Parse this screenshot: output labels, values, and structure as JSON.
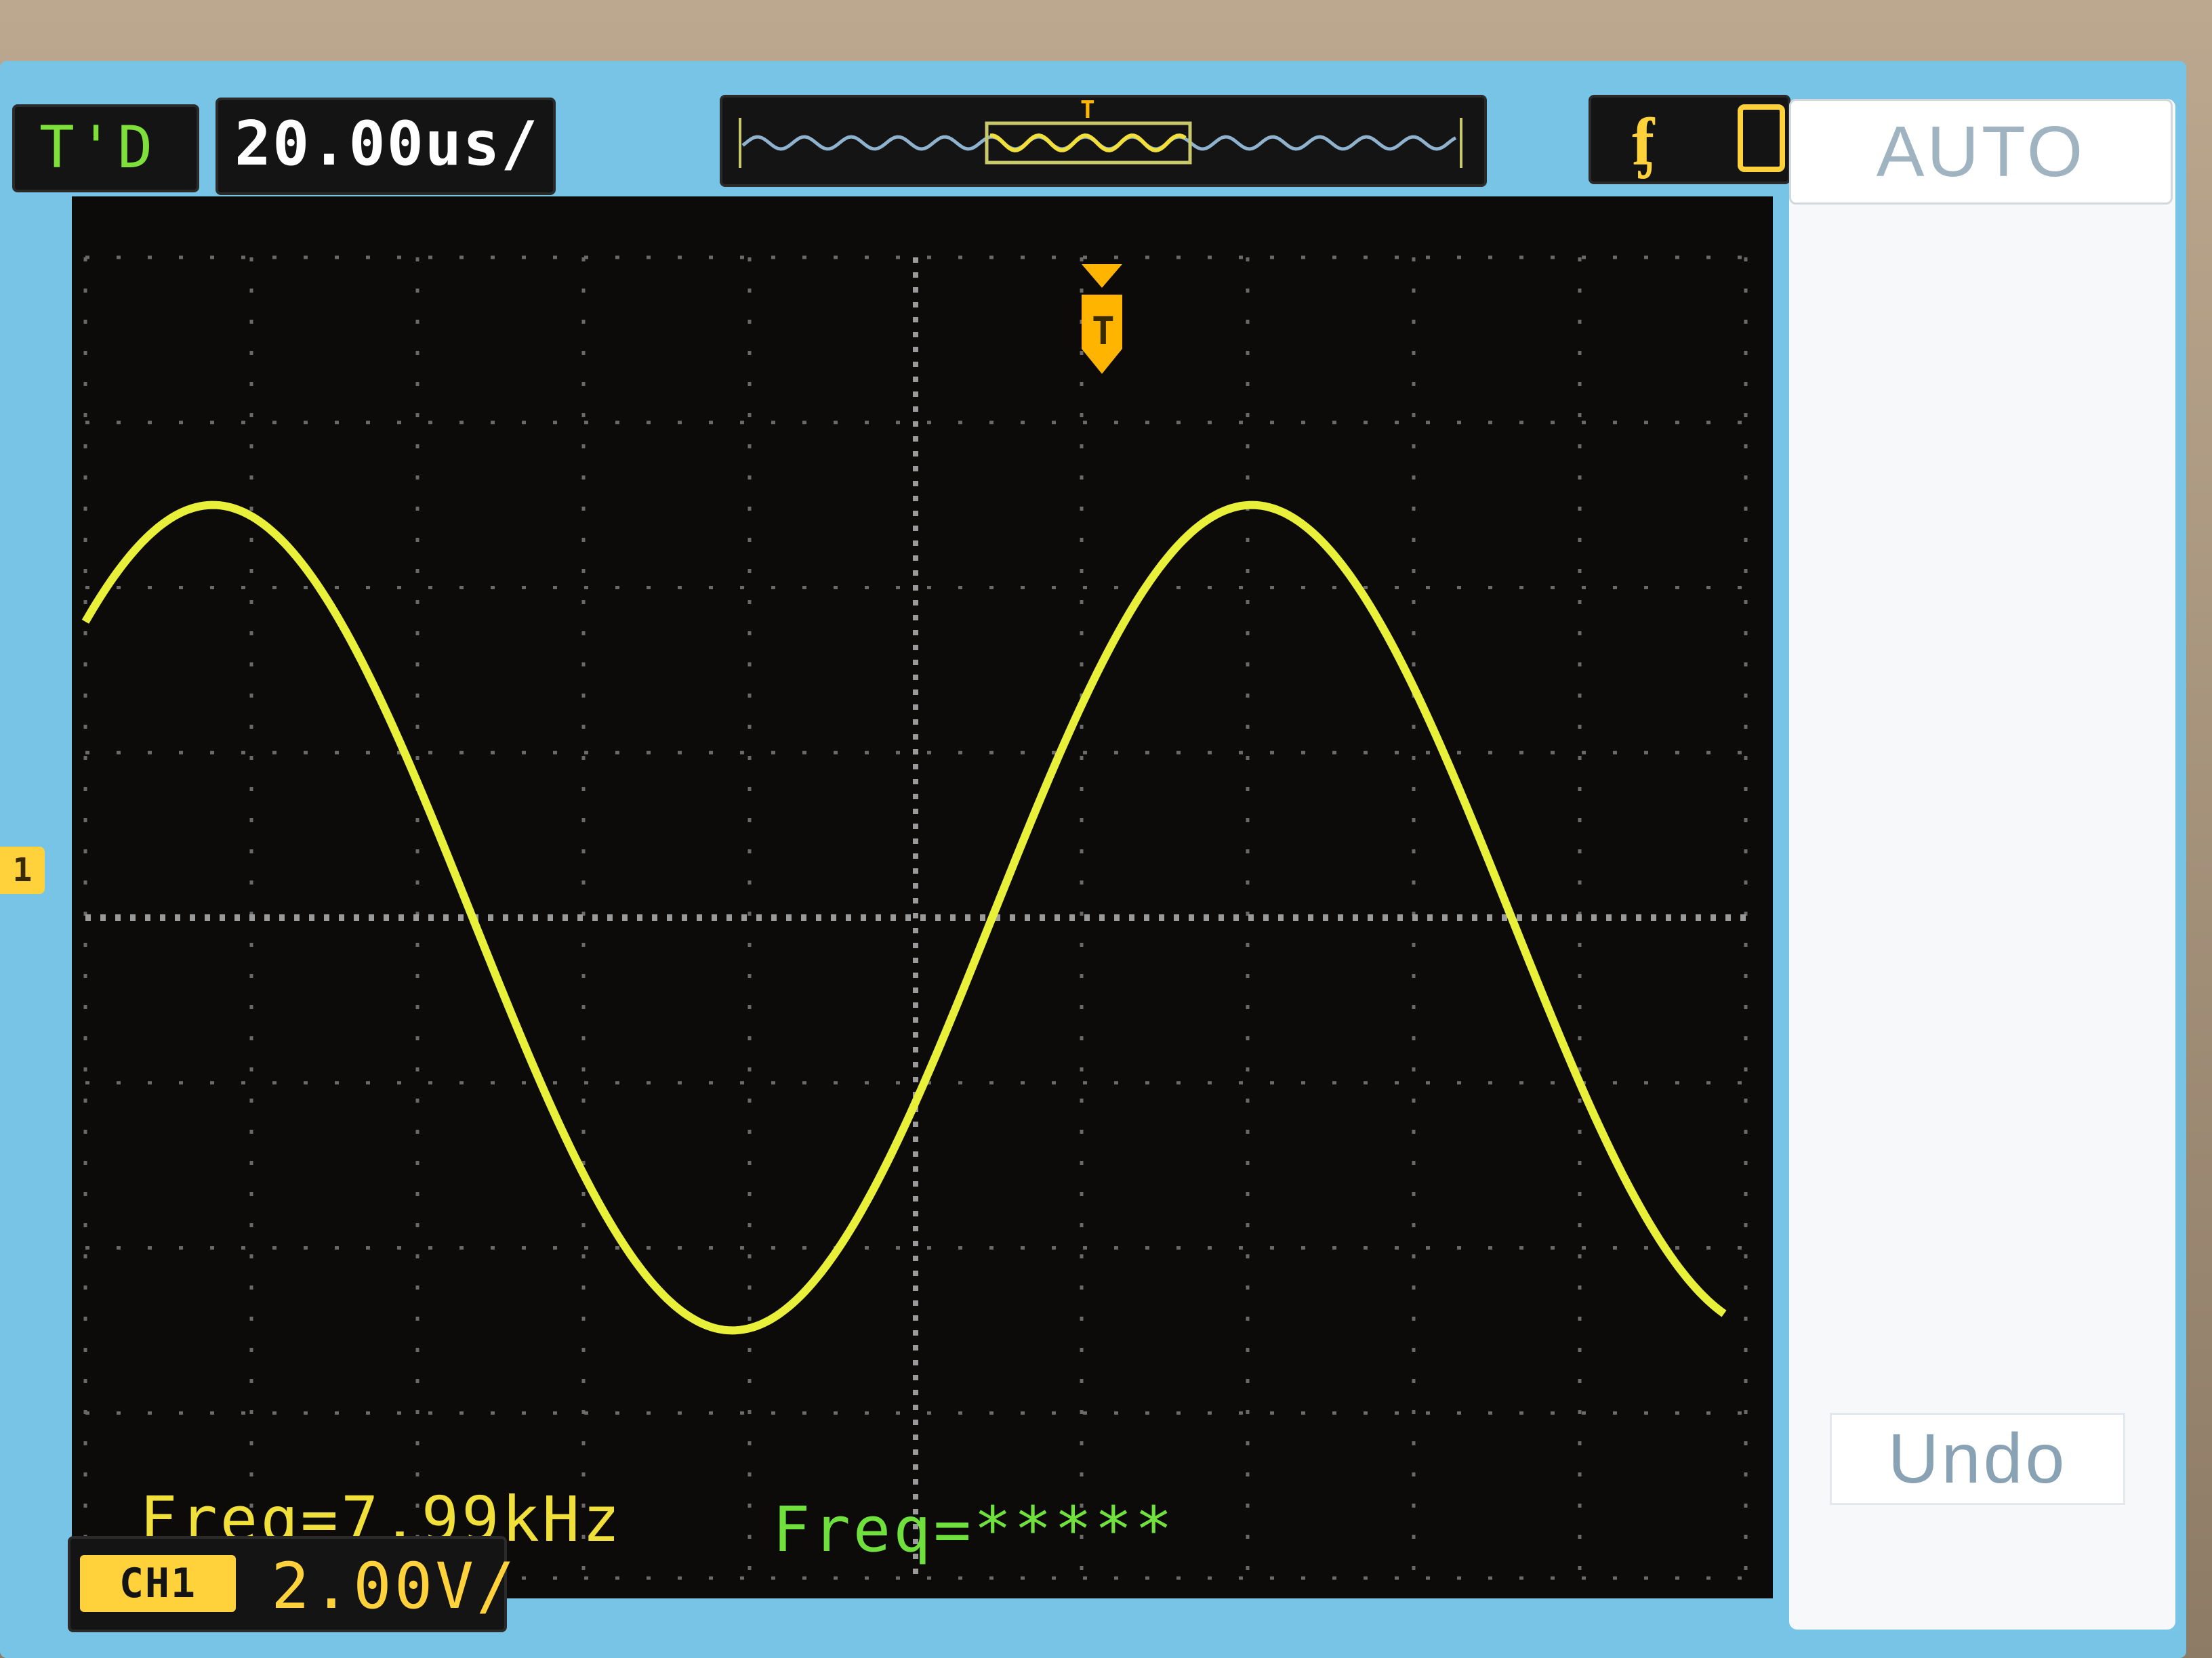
{
  "status_bar": {
    "run_state": "T'D",
    "timebase": "20.00us/",
    "trigger_slope_icon": "rising-edge-icon"
  },
  "menu": {
    "mode_label": "AUTO",
    "undo_label": "Undo"
  },
  "measurements": {
    "ch1_freq": "Freq=7.99kHz",
    "ch2_freq": "Freq=*****"
  },
  "channel": {
    "label": "CH1",
    "marker": "1",
    "volts_per_div": "2.00V/"
  },
  "trigger_marker": "T",
  "colors": {
    "trace": "#e8f03a",
    "channel": "#ffd23c",
    "measure_ch1": "#f2e03a",
    "measure_ch2": "#6fe03c",
    "screen_frame": "#78c4e6",
    "grid_bg": "#0d0b09"
  },
  "chart_data": {
    "type": "line",
    "series": [
      {
        "description_source": "waveform trace",
        "frequency_khz": 7.99,
        "peak_volts": 5.0,
        "horizontal_divisions": 10,
        "vertical_divisions": 8,
        "time_per_div_us": 20,
        "volts_per_div": 2
      }
    ]
  }
}
